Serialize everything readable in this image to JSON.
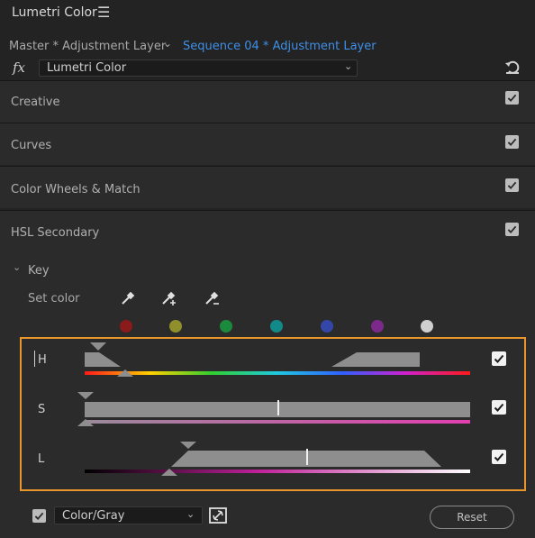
{
  "panel": {
    "title": "Lumetri Color",
    "menu_icon": "hamburger-menu-icon"
  },
  "tabs": {
    "master": "Master * Adjustment Layer",
    "sequence": "Sequence 04 * Adjustment Layer",
    "active_color": "#3f8fe8"
  },
  "effect": {
    "fx_label": "fx",
    "selected": "Lumetri Color"
  },
  "sections": [
    {
      "label": "Creative",
      "checked": true
    },
    {
      "label": "Curves",
      "checked": true
    },
    {
      "label": "Color Wheels & Match",
      "checked": true
    },
    {
      "label": "HSL Secondary",
      "checked": true
    }
  ],
  "key": {
    "label": "Key",
    "set_color_label": "Set color",
    "swatches": [
      "#8b1a1a",
      "#8f8f2c",
      "#1c8a3c",
      "#138a8a",
      "#3446a8",
      "#7b2a8c",
      "#cfcfcf"
    ]
  },
  "hsl": {
    "highlight_color": "#e8962b",
    "h_label": "H",
    "s_label": "S",
    "l_label": "L",
    "h_enabled": true,
    "s_enabled": true,
    "l_enabled": true
  },
  "bottom": {
    "show_mask_checked": true,
    "view_mode": "Color/Gray",
    "reset_label": "Reset"
  }
}
